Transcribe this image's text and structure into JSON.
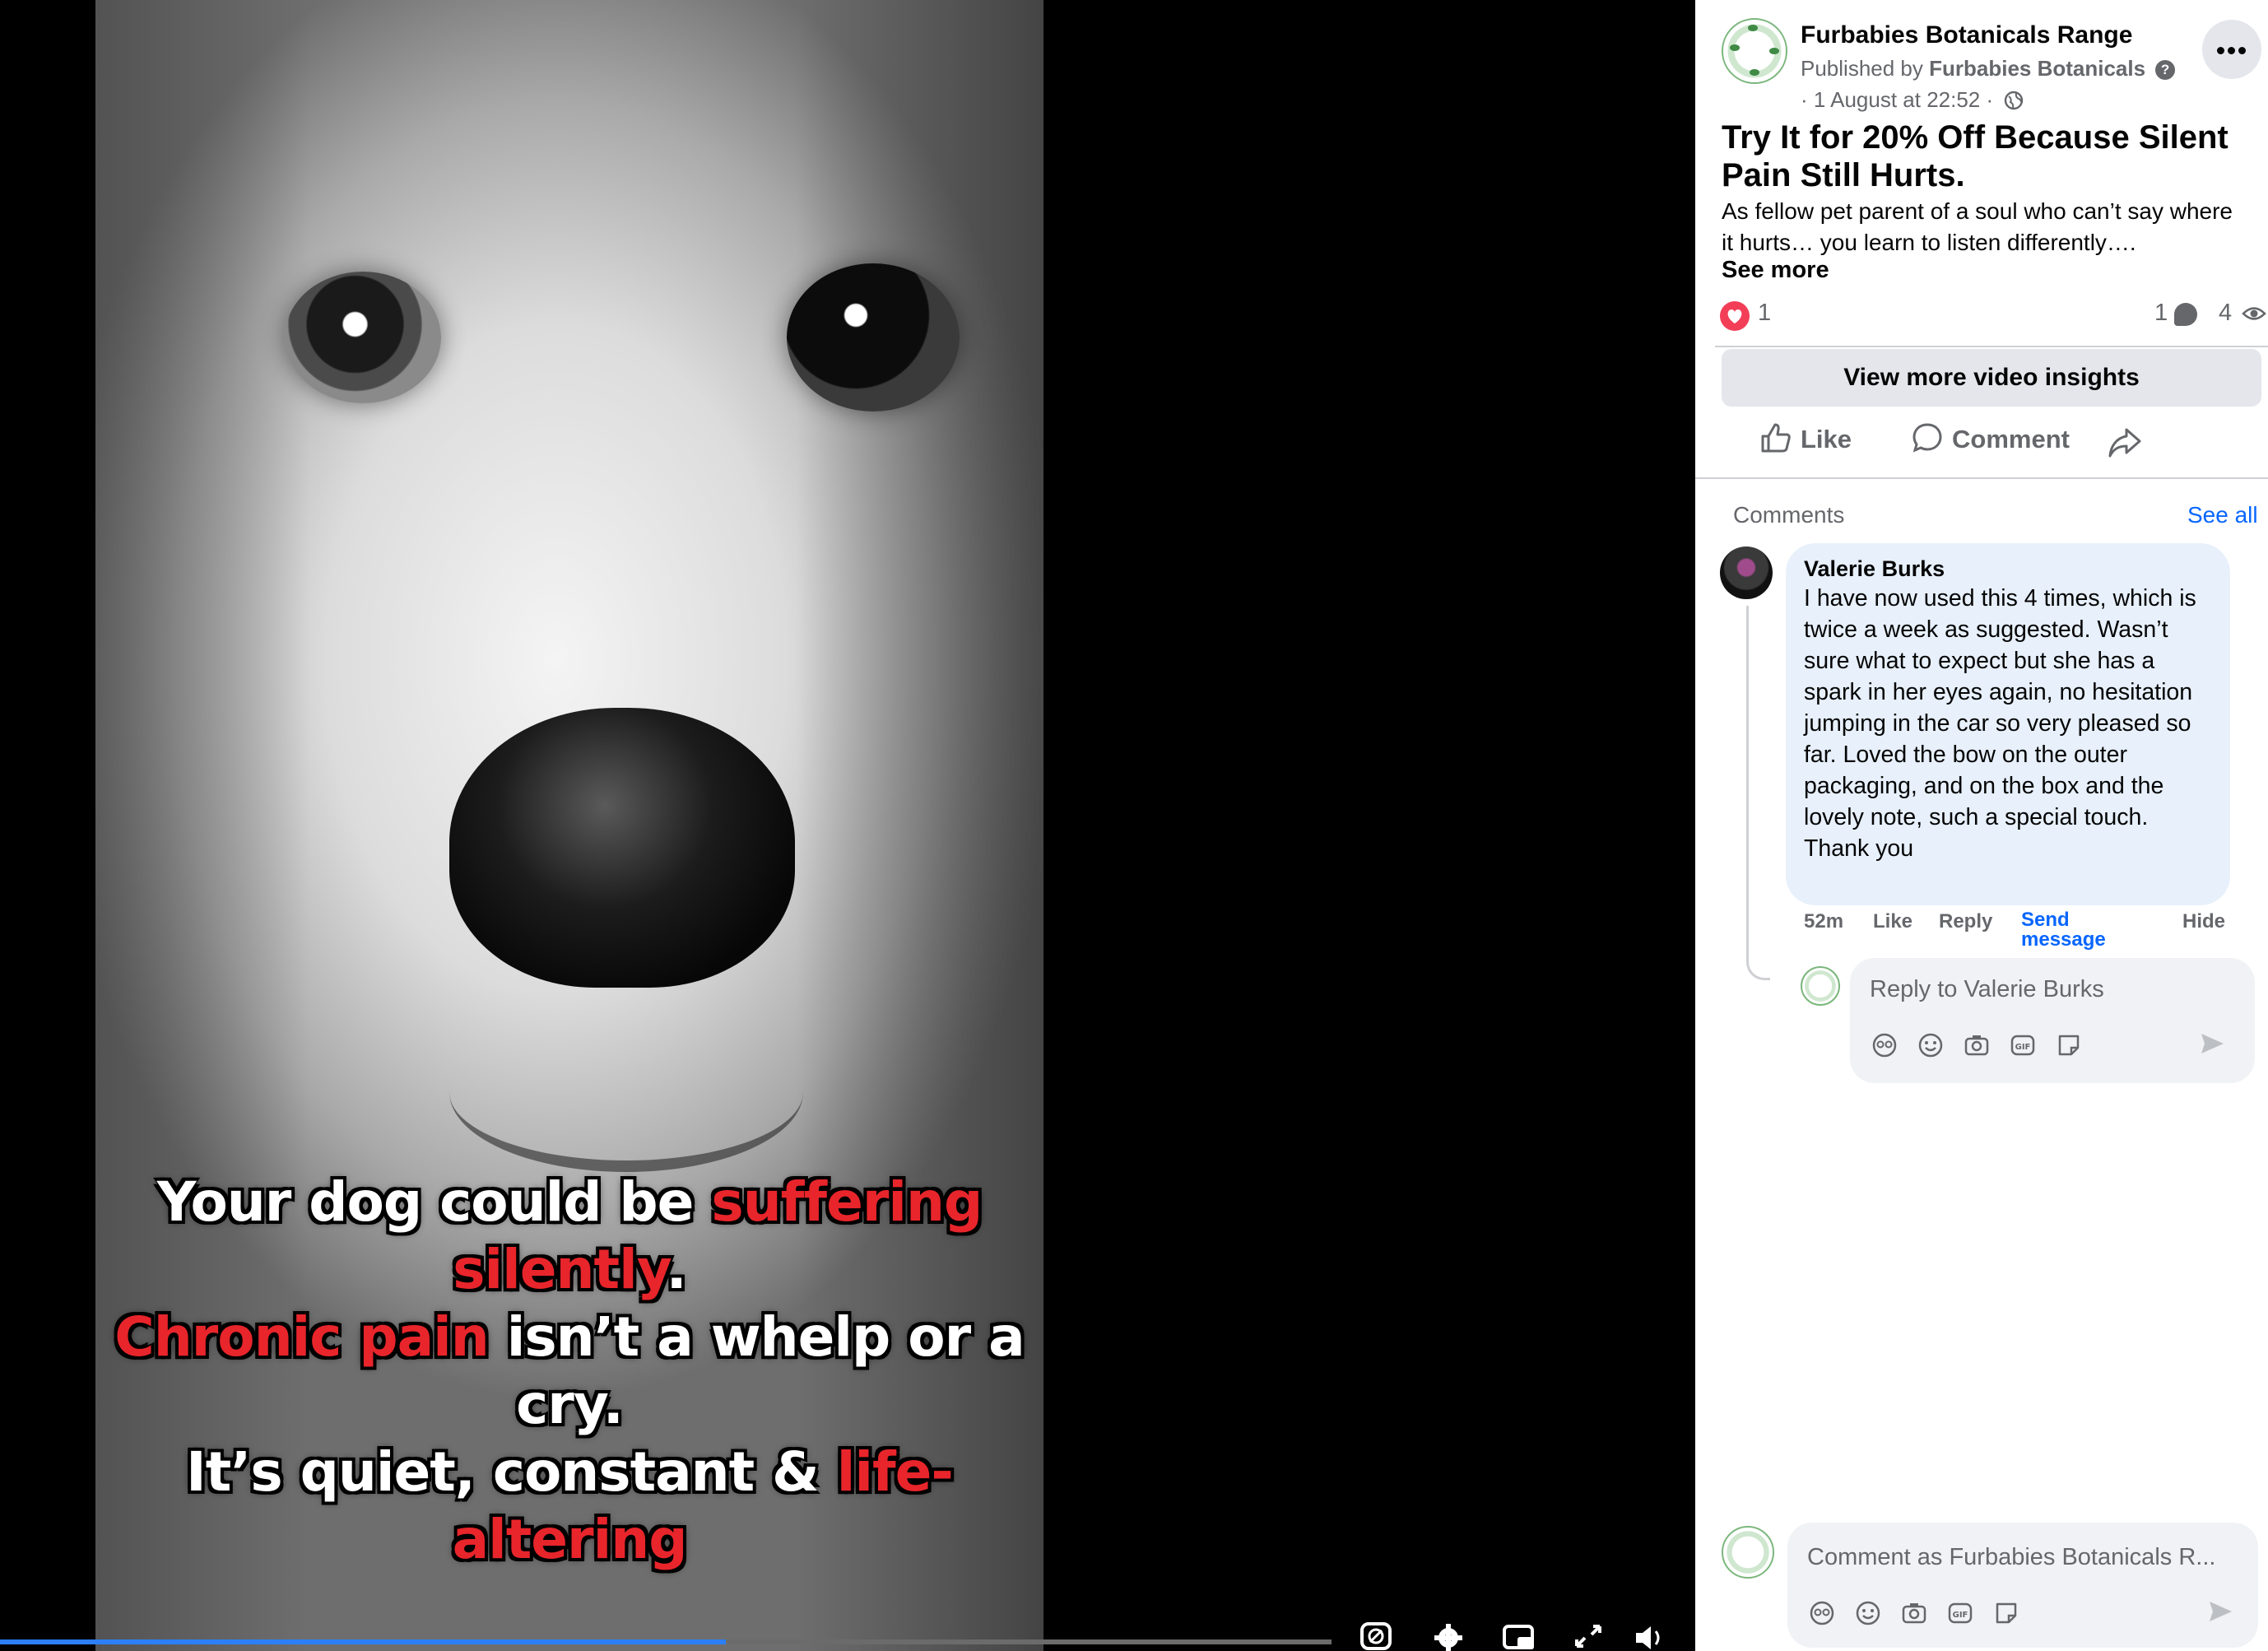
{
  "video": {
    "caption": {
      "line1_white": "Your dog could be ",
      "line1_red": "suffering silently",
      "line1_end": ".",
      "line2_red": "Chronic pain",
      "line2_white": " isn’t a whelp or a cry.",
      "line3_white": "It’s quiet, constant & ",
      "line3_red": "life-altering"
    },
    "progress_fraction": 0.545,
    "controls": [
      "autoplay-off-icon",
      "settings-gear-icon",
      "picture-in-picture-icon",
      "fullscreen-icon",
      "volume-icon"
    ]
  },
  "post": {
    "page_name": "Furbabies Botanicals Range",
    "published_by_prefix": "Published by ",
    "publisher": "Furbabies Botanicals",
    "help_glyph": "?",
    "date": "· 1 August at 22:52 ·",
    "title": "Try It for 20% Off Because Silent Pain Still Hurts.",
    "body": "As fellow pet parent of a soul who can’t say where it hurts… you learn to listen differently….",
    "see_more": "See more",
    "reactions": "1",
    "comments_count": "1",
    "views": "4",
    "insights_button": "View more video insights",
    "like_label": "Like",
    "comment_label": "Comment"
  },
  "comments": {
    "heading": "Comments",
    "see_all": "See all",
    "items": [
      {
        "author": "Valerie Burks",
        "text": "I have now used this 4 times, which is twice a week as suggested. Wasn’t sure what to expect but she has a spark in her eyes again, no hesitation jumping in the car so very pleased so far. Loved the bow on the outer packaging, and on the box and the lovely note, such a special touch. Thank you",
        "time": "52m",
        "like": "Like",
        "reply": "Reply",
        "send_message": "Send message",
        "hide": "Hide"
      }
    ],
    "reply_placeholder": "Reply to Valerie Burks",
    "composer_placeholder": "Comment as Furbabies Botanicals R...",
    "colors": {
      "accent_link": "#0866ff",
      "bubble": "#e7f0fb",
      "heart": "#f33e58"
    }
  }
}
